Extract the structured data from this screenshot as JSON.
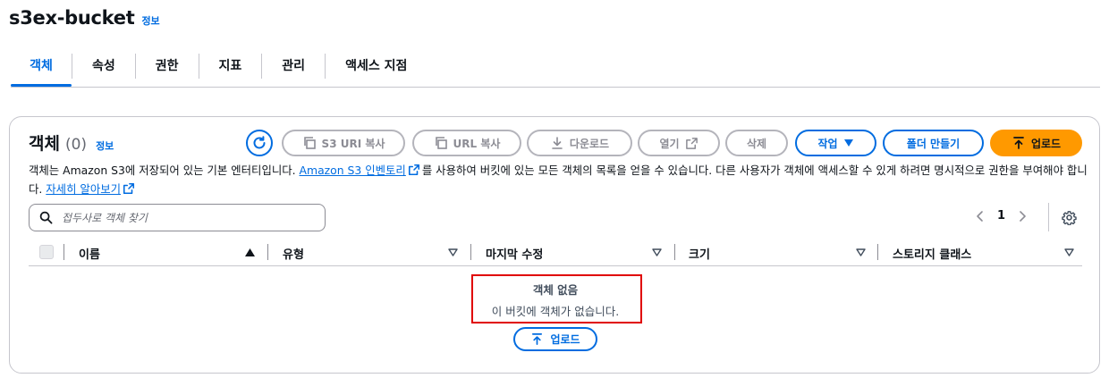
{
  "header": {
    "title": "s3ex-bucket",
    "info": "정보"
  },
  "tabs": [
    {
      "label": "객체",
      "active": true
    },
    {
      "label": "속성"
    },
    {
      "label": "권한"
    },
    {
      "label": "지표"
    },
    {
      "label": "관리"
    },
    {
      "label": "액세스 지점"
    }
  ],
  "objects": {
    "title": "객체",
    "count": "(0)",
    "info": "정보",
    "toolbar": {
      "copy_s3_uri": "S3 URI 복사",
      "copy_url": "URL 복사",
      "download": "다운로드",
      "open": "열기",
      "delete": "삭제",
      "actions": "작업",
      "create_folder": "폴더 만들기",
      "upload": "업로드"
    },
    "description": {
      "part1": "객체는 Amazon S3에 저장되어 있는 기본 엔터티입니다. ",
      "inventory_link": "Amazon S3 인벤토리",
      "part2": "를 사용하여 버킷에 있는 모든 객체의 목록을 얻을 수 있습니다. 다른 사용자가 객체에 액세스할 수 있게 하려면 명시적으로 권한을 부여해야 합니다. ",
      "learn_more": "자세히 알아보기"
    },
    "search": {
      "placeholder": "접두사로 객체 찾기"
    },
    "pagination": {
      "page": "1"
    },
    "columns": [
      "이름",
      "유형",
      "마지막 수정",
      "크기",
      "스토리지 클래스"
    ],
    "empty": {
      "title": "객체 없음",
      "subtitle": "이 버킷에 객체가 없습니다.",
      "upload": "업로드"
    }
  },
  "colors": {
    "accent": "#006ce0",
    "primary_button": "#ff9900",
    "highlight_border": "#e00000",
    "disabled": "#8c8c94"
  }
}
